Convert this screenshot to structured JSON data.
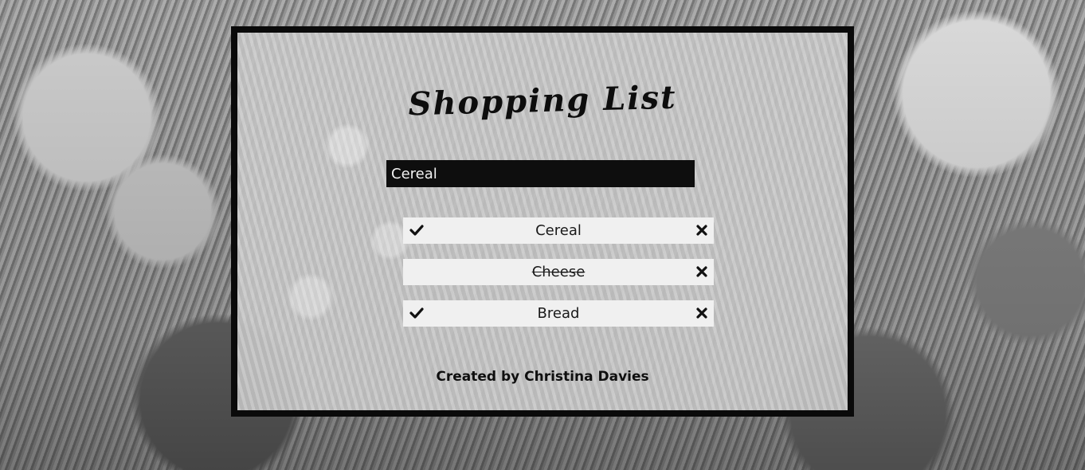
{
  "app": {
    "title": "Shopping List",
    "credit": "Created by Christina Davies"
  },
  "new_item_input": {
    "value": "Cereal"
  },
  "items": [
    {
      "label": "Cereal",
      "completed": false,
      "check_icon": "checkmark-icon",
      "delete_icon": "close-icon"
    },
    {
      "label": "Cheese",
      "completed": true,
      "check_icon": null,
      "delete_icon": "close-icon"
    },
    {
      "label": "Bread",
      "completed": false,
      "check_icon": "checkmark-icon",
      "delete_icon": "close-icon"
    }
  ],
  "colors": {
    "frame": "#0a0a0a",
    "input_bg": "#0e0e0e",
    "input_text": "#f2f2f2",
    "item_bg": "#f0f0f0"
  }
}
